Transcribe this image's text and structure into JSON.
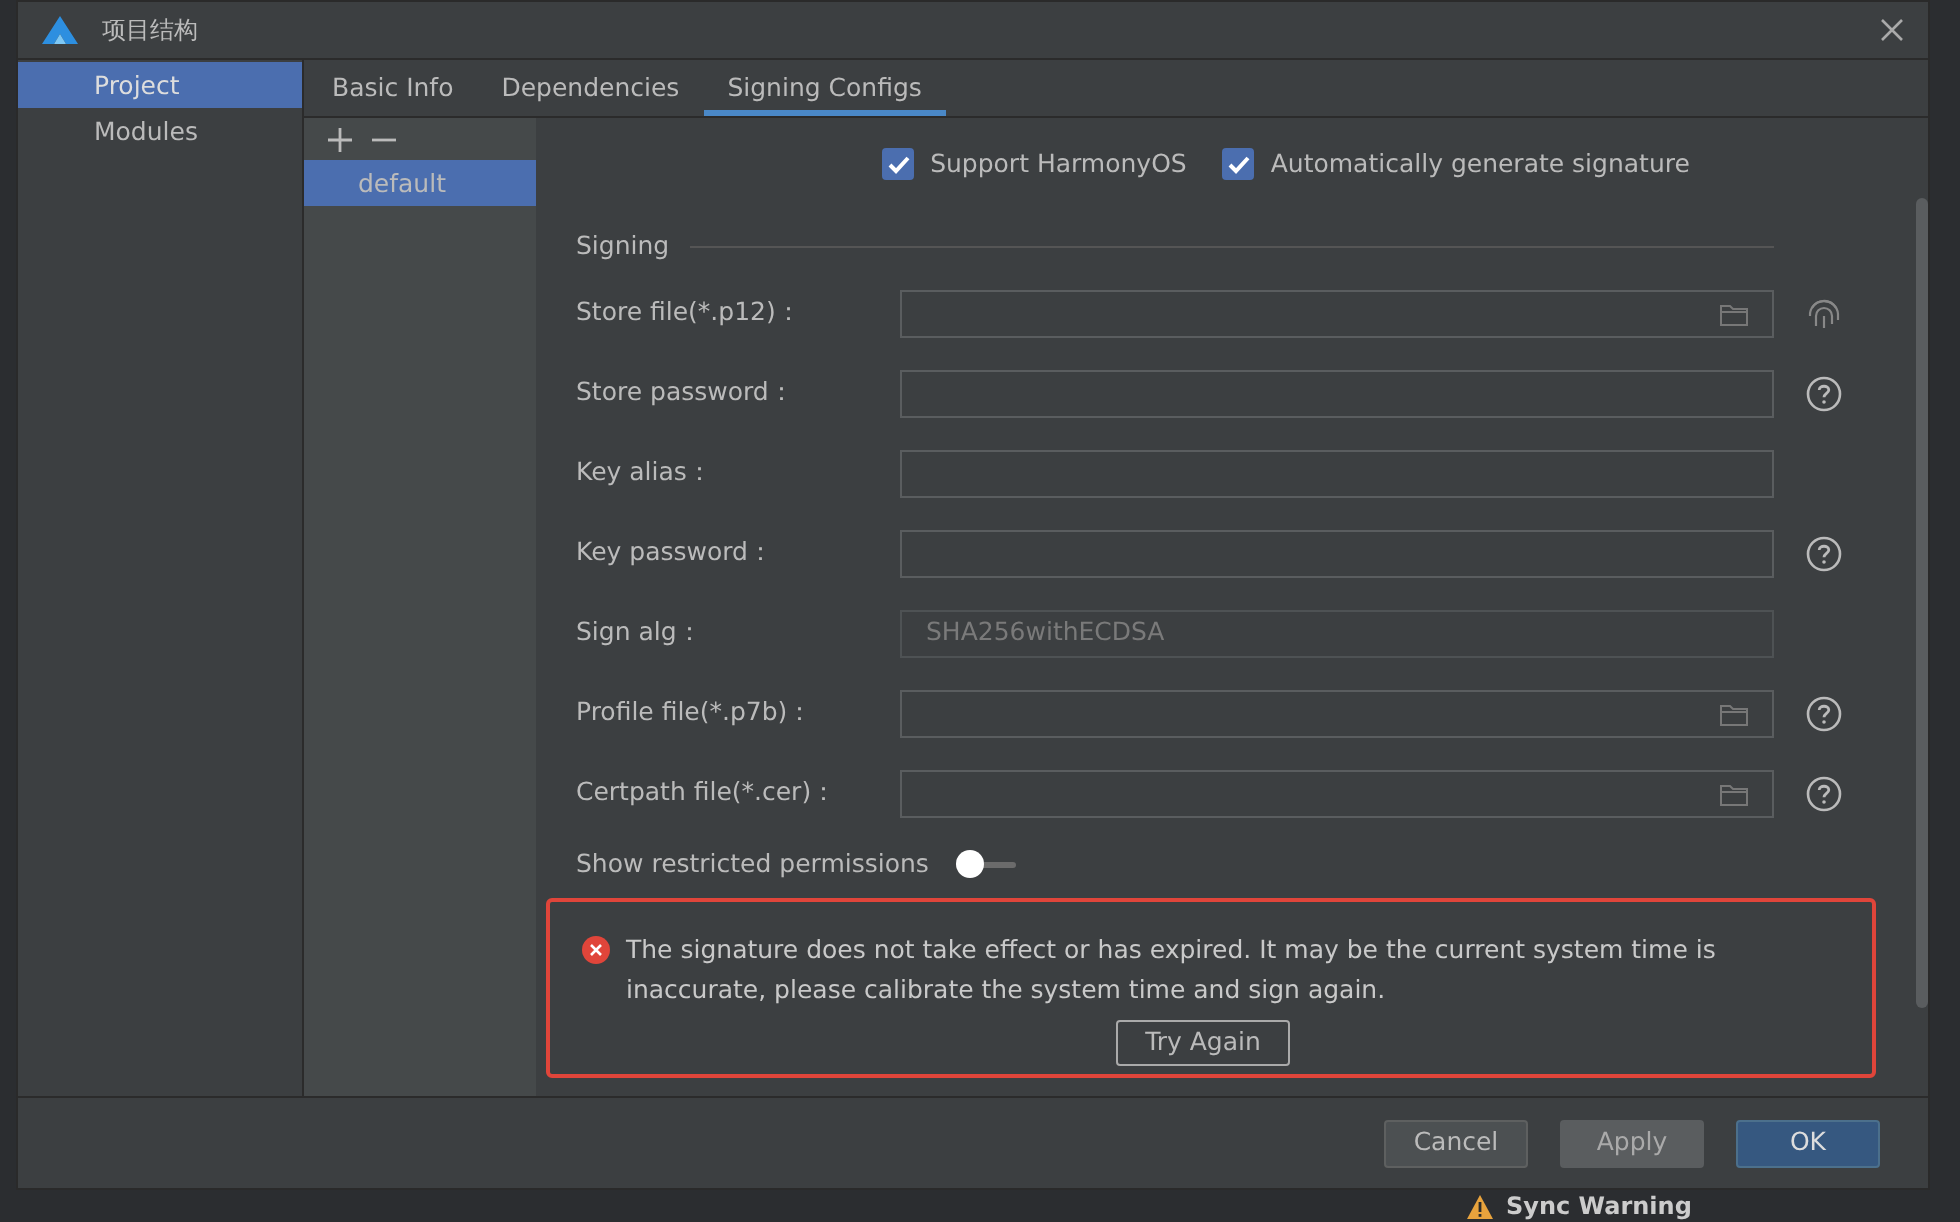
{
  "window": {
    "title": "项目结构"
  },
  "sidebar": {
    "items": [
      {
        "label": "Project",
        "selected": true
      },
      {
        "label": "Modules",
        "selected": false
      }
    ]
  },
  "tabs": [
    {
      "label": "Basic Info",
      "selected": false
    },
    {
      "label": "Dependencies",
      "selected": false
    },
    {
      "label": "Signing Configs",
      "selected": true
    }
  ],
  "config_list": {
    "items": [
      {
        "label": "default",
        "selected": true
      }
    ]
  },
  "options": [
    {
      "label": "Support HarmonyOS",
      "checked": true
    },
    {
      "label": "Automatically generate signature",
      "checked": true
    }
  ],
  "signing": {
    "title": "Signing",
    "fields": [
      {
        "label": "Store file(*.p12)：",
        "kind": "file",
        "fingerprint": true,
        "disabled": false
      },
      {
        "label": "Store password：",
        "kind": "text",
        "help": true,
        "disabled": false
      },
      {
        "label": "Key alias：",
        "kind": "text",
        "disabled": false
      },
      {
        "label": "Key password：",
        "kind": "text",
        "help": true,
        "disabled": false
      },
      {
        "label": "Sign alg：",
        "kind": "text",
        "value": "SHA256withECDSA",
        "disabled": true
      },
      {
        "label": "Profile file(*.p7b)：",
        "kind": "file",
        "help": true,
        "disabled": false
      },
      {
        "label": "Certpath file(*.cer)：",
        "kind": "file",
        "help": true,
        "disabled": false
      }
    ]
  },
  "toggle": {
    "label": "Show restricted permissions",
    "on": false
  },
  "error": {
    "message": "The signature does not take effect or has expired. It may be the current system time is inaccurate, please calibrate the system time and sign again.",
    "action": "Try Again"
  },
  "buttons": [
    {
      "label": "Cancel",
      "kind": "plain"
    },
    {
      "label": "Apply",
      "kind": "muted"
    },
    {
      "label": "OK",
      "kind": "primary"
    }
  ],
  "background": {
    "notice": "Sync Warning"
  }
}
